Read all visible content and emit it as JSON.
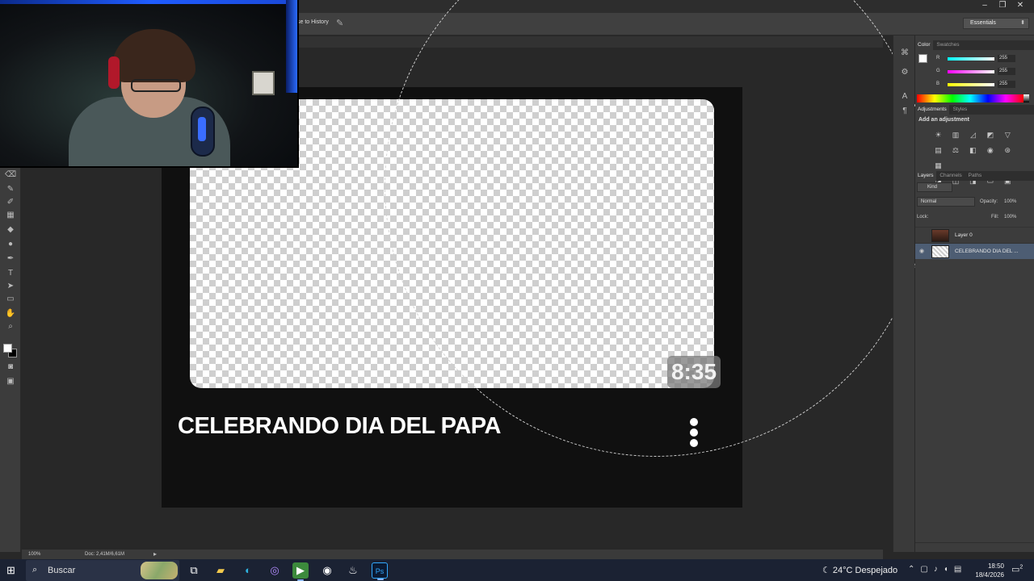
{
  "app": {
    "window_controls": {
      "minimize": "–",
      "maximize": "❐",
      "close": "✕"
    },
    "options_bar": {
      "history_label": "se to History",
      "workspace": "Essentials"
    }
  },
  "canvas": {
    "video_title": "CELEBRANDO DIA DEL PAPA",
    "duration": "8:35"
  },
  "status_bar": {
    "zoom": "100%",
    "doc_info": "Doc: 2,41M/6,61M"
  },
  "color_panel": {
    "tabs": [
      "Color",
      "Swatches"
    ],
    "r_label": "R",
    "r_value": "255",
    "g_label": "G",
    "g_value": "255",
    "b_label": "B",
    "b_value": "255"
  },
  "adjustments_panel": {
    "tabs": [
      "Adjustments",
      "Styles"
    ],
    "title": "Add an adjustment"
  },
  "layers_panel": {
    "tabs": [
      "Layers",
      "Channels",
      "Paths"
    ],
    "kind_label": "Kind",
    "blend_mode": "Normal",
    "opacity_label": "Opacity:",
    "opacity_value": "100%",
    "lock_label": "Lock:",
    "fill_label": "Fill:",
    "fill_value": "100%",
    "layers": [
      {
        "name": "Layer 0",
        "selected": false
      },
      {
        "name": "CELEBRANDO DIA DEL ...",
        "selected": true
      }
    ]
  },
  "taskbar": {
    "search_placeholder": "Buscar",
    "weather": "24°C  Despejado",
    "time": "18:50",
    "date": "18/4/2026",
    "notification_count": "2"
  },
  "colors": {
    "accent": "#4d5d73",
    "taskbar": "#1b2233",
    "led_blue": "#1f5cff"
  }
}
